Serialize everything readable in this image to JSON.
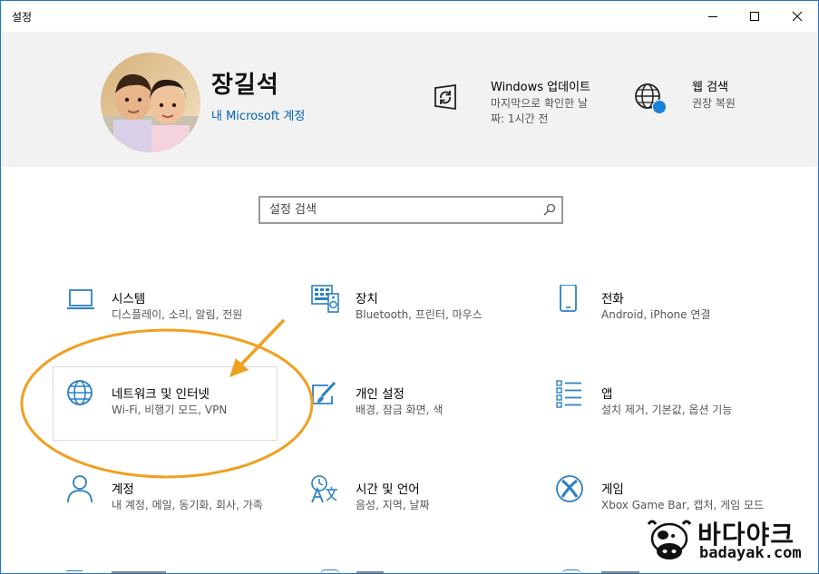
{
  "window": {
    "title": "설정"
  },
  "header": {
    "user_name": "장길석",
    "account_link": "내 Microsoft 계정",
    "windows_update": {
      "title": "Windows 업데이트",
      "subtitle_line1": "마지막으로 확인한 날",
      "subtitle_line2": "짜: 1시간 전",
      "icon": "sync-icon"
    },
    "web_search": {
      "title": "웹 검색",
      "subtitle": "권장 복원",
      "icon": "globe-icon"
    }
  },
  "search": {
    "placeholder": "설정 검색"
  },
  "tiles": [
    {
      "name": "시스템",
      "desc": "디스플레이, 소리, 알림, 전원",
      "icon": "laptop-icon"
    },
    {
      "name": "장치",
      "desc": "Bluetooth, 프린터, 마우스",
      "icon": "keyboard-icon"
    },
    {
      "name": "전화",
      "desc": "Android, iPhone 연결",
      "icon": "phone-icon"
    },
    {
      "name": "네트워크 및 인터넷",
      "desc": "Wi-Fi, 비행기 모드, VPN",
      "icon": "globe-icon"
    },
    {
      "name": "개인 설정",
      "desc": "배경, 잠금 화면, 색",
      "icon": "paint-icon"
    },
    {
      "name": "앱",
      "desc": "설치 제거, 기본값, 옵션 기능",
      "icon": "apps-list-icon"
    },
    {
      "name": "계정",
      "desc": "내 계정, 메일, 동기화, 회사, 가족",
      "icon": "person-icon"
    },
    {
      "name": "시간 및 언어",
      "desc": "음성, 지역, 날짜",
      "icon": "time-language-icon"
    },
    {
      "name": "게임",
      "desc": "Xbox Game Bar, 캡처, 게임 모드",
      "icon": "xbox-icon"
    }
  ],
  "watermark": {
    "korean": "바다야크",
    "domain": "badayak.com"
  },
  "colors": {
    "accent": "#0063b1",
    "icon_blue": "#2a80c2",
    "annotation_orange": "#f0a020",
    "header_bg": "#f2f2f2"
  }
}
